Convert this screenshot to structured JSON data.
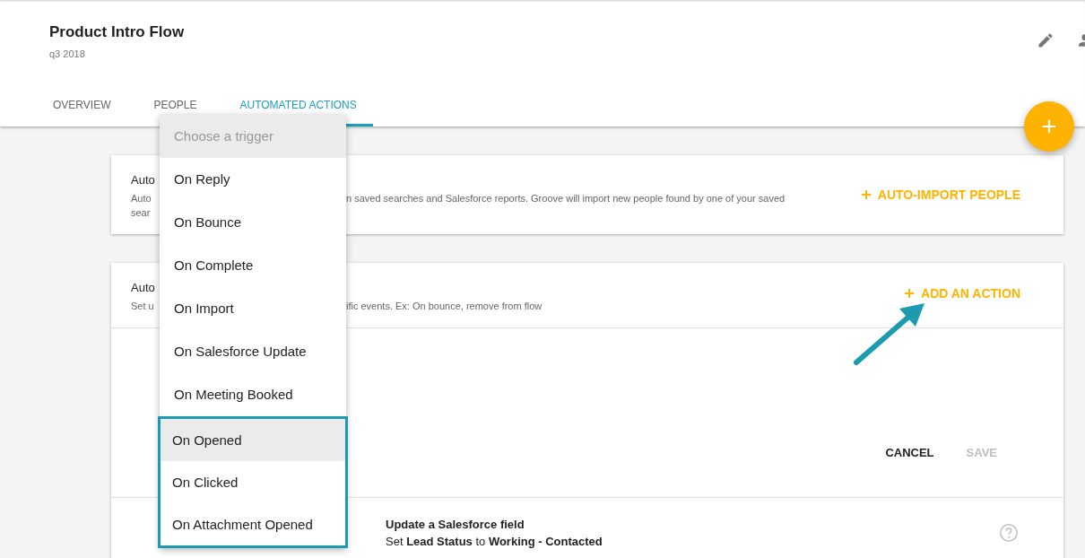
{
  "header": {
    "title": "Product Intro Flow",
    "subtitle": "q3 2018"
  },
  "tabs": [
    {
      "label": "OVERVIEW",
      "selected": false
    },
    {
      "label": "PEOPLE",
      "selected": false
    },
    {
      "label": "AUTOMATED ACTIONS",
      "selected": true
    }
  ],
  "cards": [
    {
      "title": "Auto",
      "description": [
        {
          "left": "Auto",
          "right": "n saved searches and Salesforce reports. Groove will import new people found by one of your saved"
        },
        {
          "left": "sear"
        }
      ],
      "action": "AUTO-IMPORT PEOPLE"
    },
    {
      "title": "Auto",
      "description": [
        {
          "left": "Set u",
          "right": "ific events. Ex: On bounce, remove from flow"
        }
      ],
      "action": "ADD AN ACTION",
      "form_buttons": [
        {
          "label": "CANCEL",
          "disabled": false
        },
        {
          "label": "SAVE",
          "disabled": true
        }
      ],
      "rows": [
        {
          "title": "Update a Salesforce field",
          "detail": "Set **Lead Status** to **Working - Contacted**"
        }
      ]
    }
  ],
  "trigger_menu": {
    "placeholder": "Choose a trigger",
    "items": [
      {
        "label": "On Reply",
        "selected": false,
        "outlined": false
      },
      {
        "label": "On Bounce",
        "selected": false,
        "outlined": false
      },
      {
        "label": "On Complete",
        "selected": false,
        "outlined": false
      },
      {
        "label": "On Import",
        "selected": false,
        "outlined": false
      },
      {
        "label": "On Salesforce Update",
        "selected": false,
        "outlined": false
      },
      {
        "label": "On Meeting Booked",
        "selected": false,
        "outlined": false
      },
      {
        "label": "On Opened",
        "selected": true,
        "outlined": true
      },
      {
        "label": "On Clicked",
        "selected": false,
        "outlined": true
      },
      {
        "label": "On Attachment Opened",
        "selected": false,
        "outlined": true
      }
    ]
  }
}
